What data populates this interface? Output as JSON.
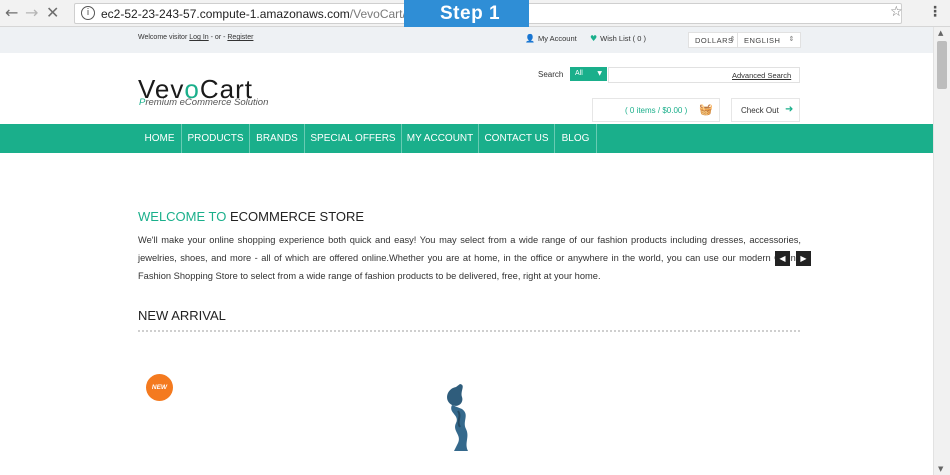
{
  "browser": {
    "url_host": "ec2-52-23-243-57.compute-1.amazonaws.com",
    "url_path": "/VevoCart/",
    "overlay_label": "Step 1"
  },
  "topbar": {
    "welcome_prefix": "Welcome visitor",
    "login_label": "Log In",
    "or_label": " - or - ",
    "register_label": "Register",
    "my_account_label": "My Account",
    "wish_list_label": "Wish List ( 0 )",
    "currency": "DOLLARS",
    "language": "ENGLISH"
  },
  "header": {
    "logo_pre": "Vev",
    "logo_o": "o",
    "logo_post": "Cart",
    "tagline_pre": "P",
    "tagline_rest": "remium eCommerce Solution",
    "search_label": "Search",
    "search_category": "All",
    "search_value": "",
    "advanced_search_label": "Advanced Search",
    "cart_summary": "( 0 items / $0.00 )",
    "checkout_label": "Check Out"
  },
  "nav": {
    "items": [
      "HOME",
      "PRODUCTS",
      "BRANDS",
      "SPECIAL OFFERS",
      "MY ACCOUNT",
      "CONTACT US",
      "BLOG"
    ]
  },
  "welcome": {
    "title_pre": "WELCOME TO",
    "title_post": "ECOMMERCE STORE",
    "body": "We'll make your online shopping experience both quick and easy! You may select from a wide range of our fashion products including dresses, accessories, jewelries, shoes, and more - all of which are offered online.Whether you are at home, in the office or anywhere in the world, you can use our modern Online Fashion Shopping Store to select from a wide range of fashion products to be delivered, free, right at your home."
  },
  "new_arrival": {
    "title": "NEW ARRIVAL",
    "badge": "NEW"
  },
  "colors": {
    "brand_green": "#1aaf8b",
    "badge_orange": "#f47a1f",
    "overlay_blue": "#2f8ed6"
  }
}
